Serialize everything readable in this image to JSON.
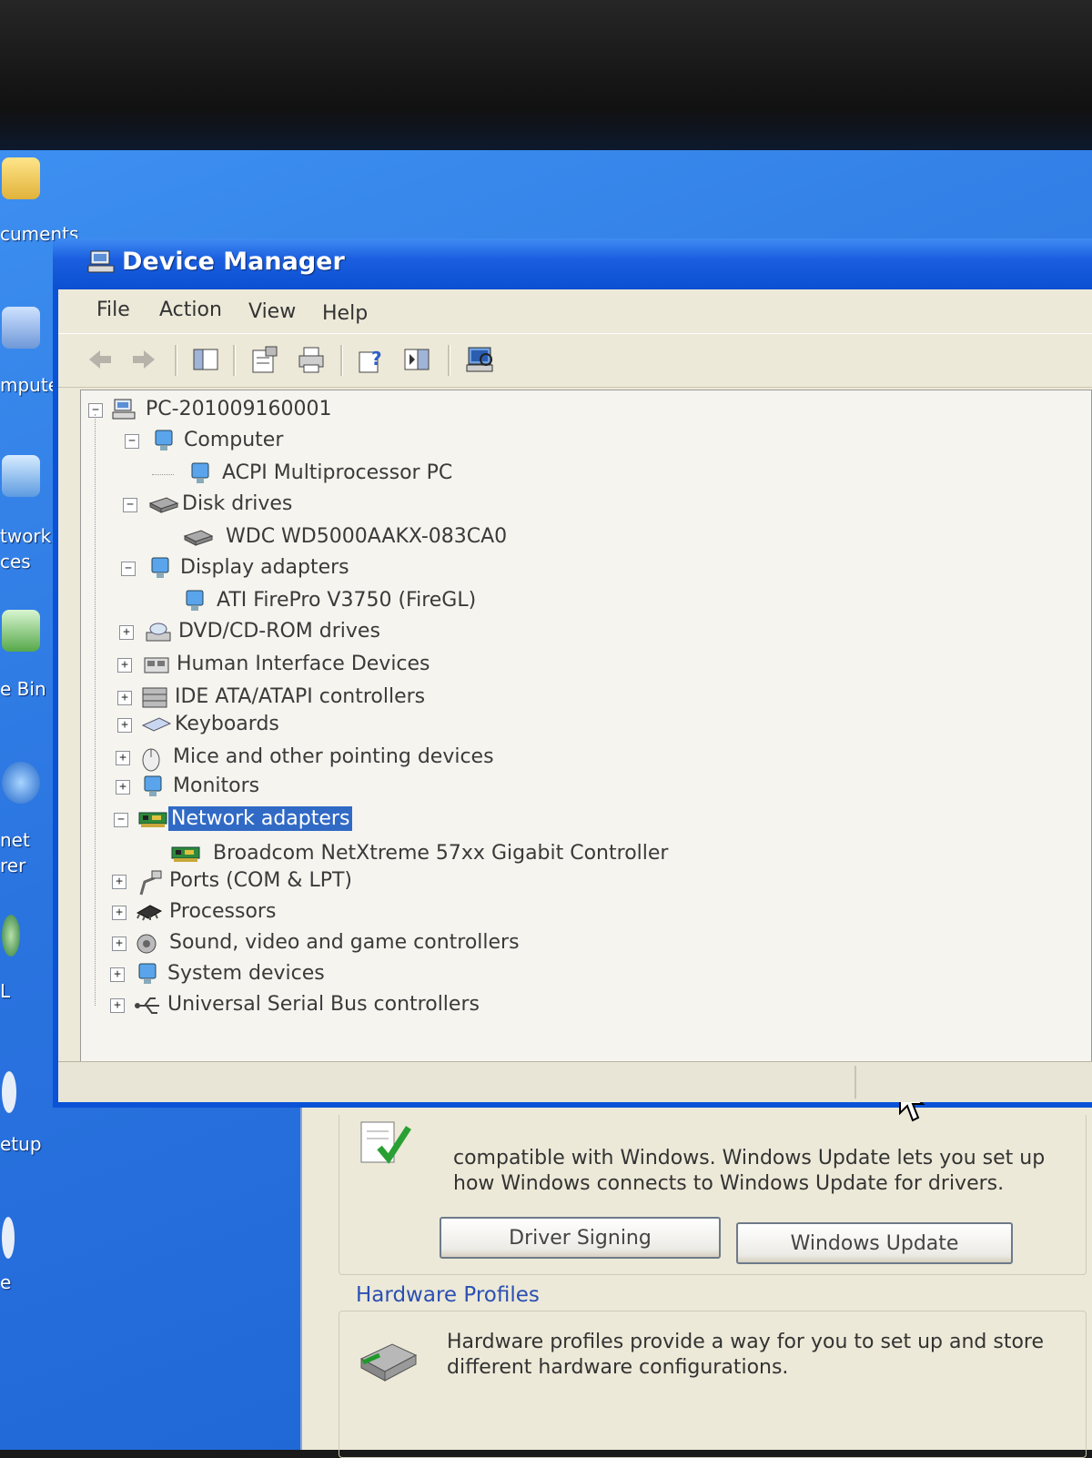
{
  "desktop": {
    "icons": [
      {
        "label": "cuments"
      },
      {
        "label": "mputer"
      },
      {
        "label": "twork"
      },
      {
        "label": "ces"
      },
      {
        "label": "e Bin"
      },
      {
        "label": "net"
      },
      {
        "label": "rer"
      },
      {
        "label": "L"
      },
      {
        "label": "etup"
      },
      {
        "label": "e"
      }
    ]
  },
  "window": {
    "title": "Device Manager",
    "menu": [
      "File",
      "Action",
      "View",
      "Help"
    ],
    "toolbar": [
      "back-icon",
      "forward-icon",
      "show-hide-tree-icon",
      "properties-icon",
      "print-icon",
      "help-icon",
      "console-icon",
      "scan-hardware-icon"
    ]
  },
  "tree": {
    "root": "PC-201009160001",
    "categories": [
      {
        "label": "Computer",
        "expanded": true,
        "children": [
          "ACPI Multiprocessor PC"
        ]
      },
      {
        "label": "Disk drives",
        "expanded": true,
        "children": [
          "WDC WD5000AAKX-083CA0"
        ]
      },
      {
        "label": "Display adapters",
        "expanded": true,
        "children": [
          "ATI FirePro V3750 (FireGL)"
        ]
      },
      {
        "label": "DVD/CD-ROM drives",
        "expanded": false
      },
      {
        "label": "Human Interface Devices",
        "expanded": false
      },
      {
        "label": "IDE ATA/ATAPI controllers",
        "expanded": false
      },
      {
        "label": "Keyboards",
        "expanded": false
      },
      {
        "label": "Mice and other pointing devices",
        "expanded": false
      },
      {
        "label": "Monitors",
        "expanded": false
      },
      {
        "label": "Network adapters",
        "expanded": true,
        "selected": true,
        "children": [
          "Broadcom NetXtreme 57xx Gigabit Controller"
        ]
      },
      {
        "label": "Ports (COM & LPT)",
        "expanded": false
      },
      {
        "label": "Processors",
        "expanded": false
      },
      {
        "label": "Sound, video and game controllers",
        "expanded": false
      },
      {
        "label": "System devices",
        "expanded": false
      },
      {
        "label": "Universal Serial Bus controllers",
        "expanded": false
      }
    ],
    "expand_symbol": "+",
    "collapse_symbol": "−"
  },
  "system_properties": {
    "driver_text_1": "compatible with Windows. Windows Update lets you set up",
    "driver_text_2": "how Windows connects to Windows Update for drivers.",
    "driver_signing_button": "Driver Signing",
    "windows_update_button": "Windows Update",
    "hardware_profiles_title": "Hardware Profiles",
    "hardware_profiles_text_1": "Hardware profiles provide a way for you to set up and store",
    "hardware_profiles_text_2": "different hardware configurations."
  },
  "colors": {
    "selection": "#316ac5",
    "titlebar": "#0b4fd2",
    "desktop": "#2a74e0"
  }
}
